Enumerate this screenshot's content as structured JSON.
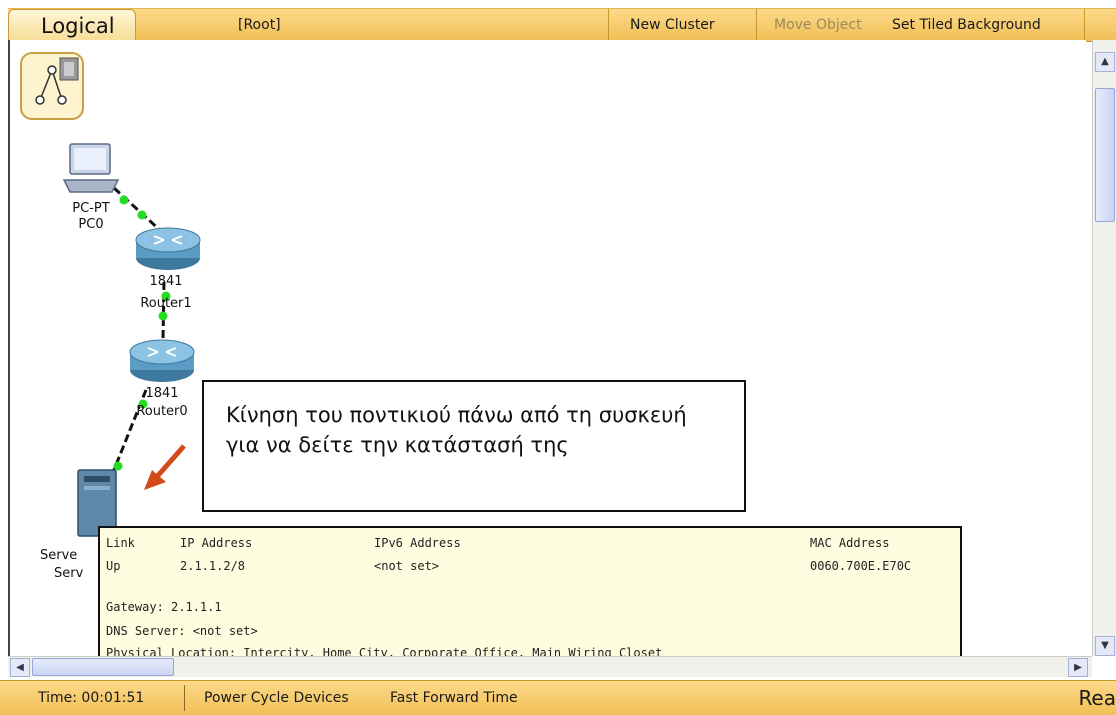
{
  "workspace": {
    "tab_label": "Logical",
    "path": "[Root]",
    "buttons": {
      "new_cluster": "New Cluster",
      "move_object": "Move Object",
      "set_tiled_background": "Set Tiled Background"
    }
  },
  "devices": {
    "pc": {
      "model": "PC-PT",
      "name": "PC0"
    },
    "router1": {
      "model": "1841",
      "name": "Router1"
    },
    "router0": {
      "model": "1841",
      "name": "Router0"
    },
    "server": {
      "model": "Serve",
      "name": "Serv"
    }
  },
  "callout": {
    "text": "Κίνηση του ποντικιού πάνω από τη συσκευή για να δείτε την κατάστασή της"
  },
  "tooltip": {
    "headers": {
      "link": "Link",
      "ip": "IP Address",
      "ipv6": "IPv6 Address",
      "mac": "MAC Address"
    },
    "row": {
      "link": "Up",
      "ip": "2.1.1.2/8",
      "ipv6": "<not set>",
      "mac": "0060.700E.E70C"
    },
    "gateway": "Gateway: 2.1.1.1",
    "dns": "DNS Server:  <not set>",
    "location": "Physical Location: Intercity, Home City, Corporate Office, Main Wiring Closet"
  },
  "status": {
    "time": "Time: 00:01:51",
    "power_cycle": "Power Cycle Devices",
    "fast_forward": "Fast Forward Time",
    "mode": "Rea"
  },
  "colors": {
    "bar": "#f5c865",
    "link_green": "#22dd22",
    "arrow": "#d24a1a",
    "tooltip_bg": "#fffde0"
  }
}
